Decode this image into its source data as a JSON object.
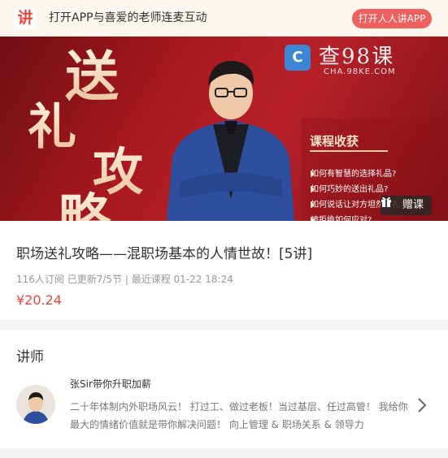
{
  "topbar": {
    "logo_glyph": "讲",
    "promo_text": "打开APP与喜爱的老师连麦互动",
    "open_app_label": "打开人人讲APP"
  },
  "banner": {
    "calligraphy": [
      "送",
      "礼",
      "攻",
      "略"
    ],
    "watermark_title": "查98课",
    "watermark_sub": "CHA.98KE.COM",
    "watermark_logo_glyph": "C",
    "gains_title": "课程收获",
    "gains": [
      "如何有智慧的选择礼品?",
      "如何巧妙的送出礼品?",
      "如何说话让对方坦然收礼?",
      "被拒绝如何应对?"
    ],
    "gift_label": "赠课"
  },
  "course": {
    "title": "职场送礼攻略——混职场基本的人情世故！[5讲]",
    "meta": "116人订阅   已更新7/5节 | 最近课程 01-22 18:24",
    "price": "¥20.24"
  },
  "lecturer": {
    "heading": "讲师",
    "name": "张Sir带你升职加薪",
    "desc": "二十年体制内外职场风云！ 打过工、做过老板！当过基层、任过高管！ 我给你最大的情绪价值就是带你解决问题！ 向上管理 & 职场关系 & 领导力"
  },
  "colors": {
    "accent": "#e8453c",
    "open_app_bg": "#ef5f5d",
    "banner_red": "#a8181f",
    "gold": "#f0cfa4"
  },
  "icons": [
    "app-logo-icon",
    "gift-icon",
    "chevron-right-icon",
    "bullet-triangle-icon"
  ]
}
